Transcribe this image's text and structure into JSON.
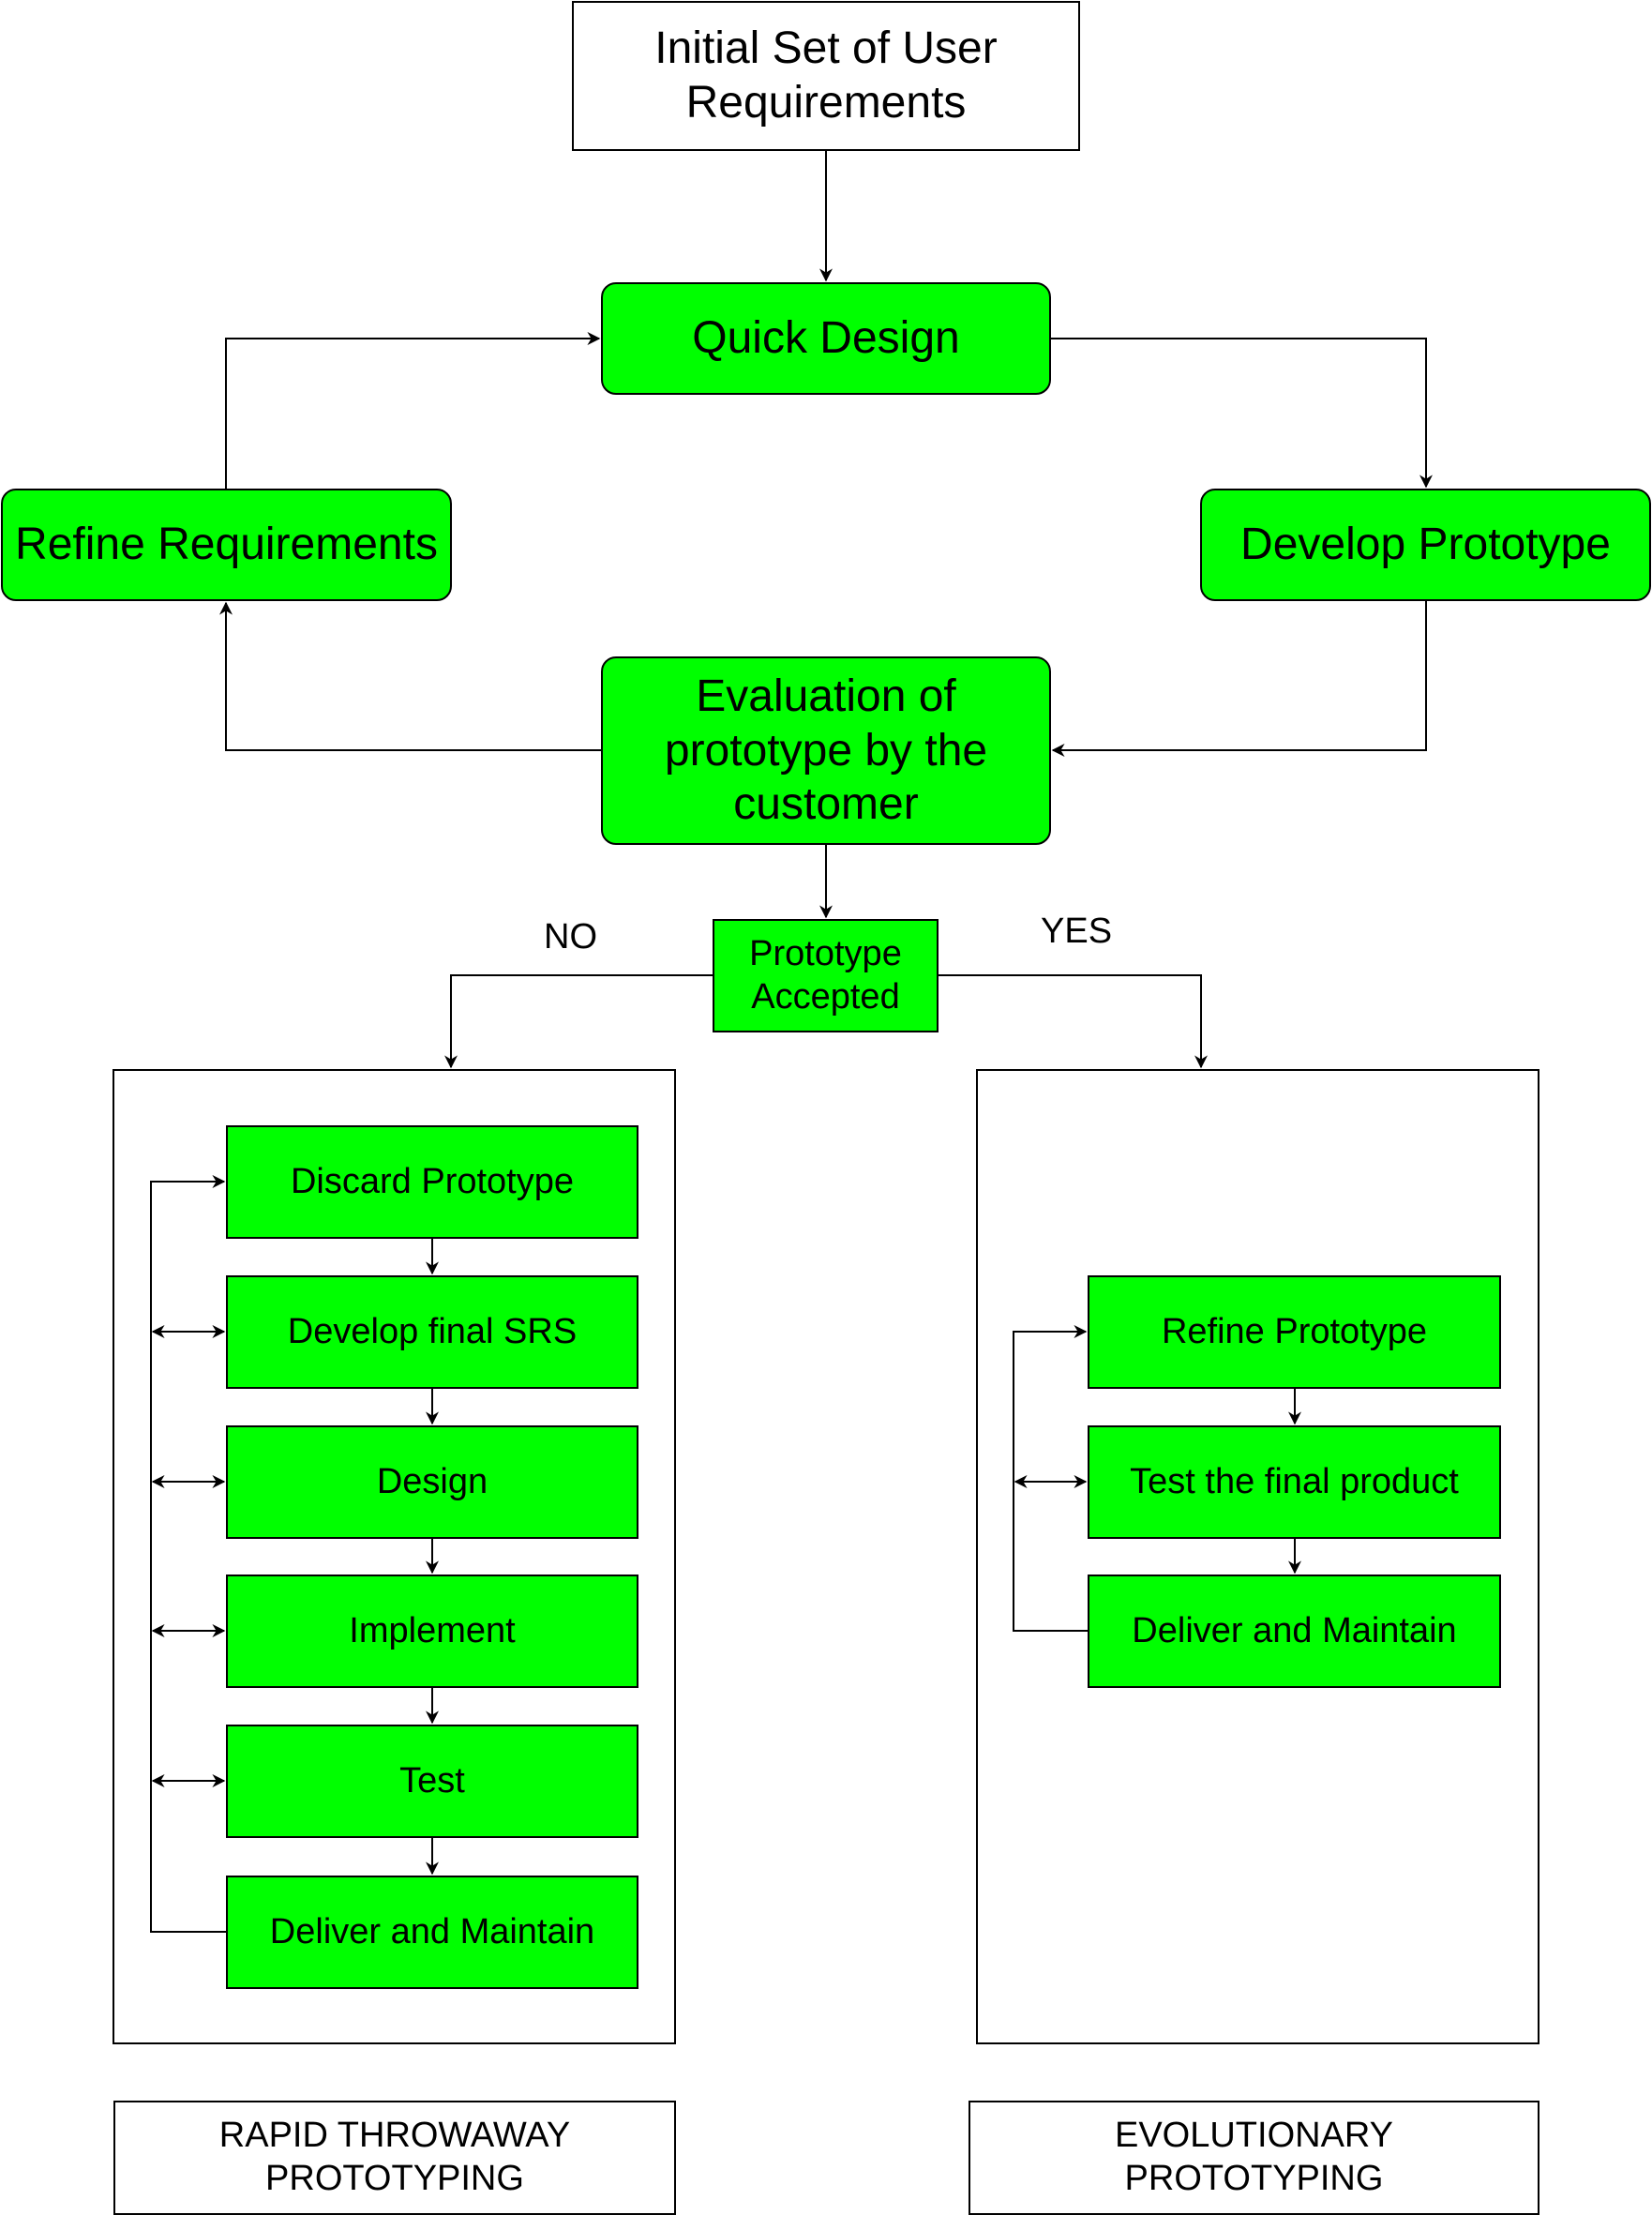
{
  "colors": {
    "node_fill": "#00ff00",
    "stroke": "#000000",
    "background": "#ffffff"
  },
  "nodes": {
    "initial": "Initial Set of User Requirements",
    "quick_design": "Quick Design",
    "refine_requirements": "Refine Requirements",
    "develop_prototype": "Develop Prototype",
    "evaluation": "Evaluation of prototype by the customer",
    "accepted": "Prototype Accepted"
  },
  "branches": {
    "no": "NO",
    "yes": "YES"
  },
  "throwaway": {
    "steps": [
      "Discard Prototype",
      "Develop final SRS",
      "Design",
      "Implement",
      "Test",
      "Deliver and Maintain"
    ],
    "title": "RAPID THROWAWAY PROTOTYPING"
  },
  "evolutionary": {
    "steps": [
      "Refine Prototype",
      "Test the final product",
      "Deliver and Maintain"
    ],
    "title": "EVOLUTIONARY PROTOTYPING"
  }
}
